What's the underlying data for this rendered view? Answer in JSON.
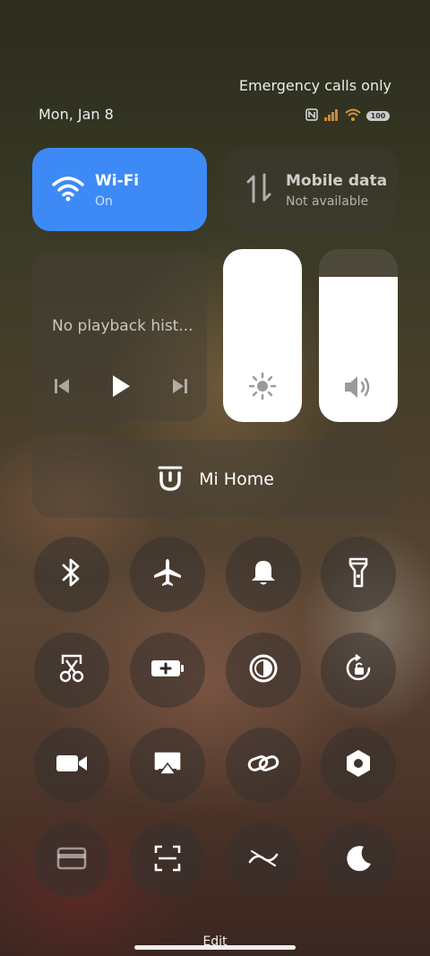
{
  "status": {
    "date": "Mon, Jan 8",
    "carrier": "Emergency calls only",
    "battery": "100"
  },
  "wifi": {
    "title": "Wi-Fi",
    "state": "On",
    "color": "#3d8af7"
  },
  "mobile_data": {
    "title": "Mobile data",
    "state": "Not available"
  },
  "media": {
    "text": "No playback hist..."
  },
  "sliders": {
    "brightness_level": 1.0,
    "volume_level": 0.84
  },
  "mi_home": {
    "label": "Mi Home"
  },
  "toggles": [
    {
      "icon": "bluetooth-icon"
    },
    {
      "icon": "airplane-icon"
    },
    {
      "icon": "bell-icon"
    },
    {
      "icon": "flashlight-icon"
    },
    {
      "icon": "screenshot-icon"
    },
    {
      "icon": "battery-saver-icon"
    },
    {
      "icon": "dark-mode-icon"
    },
    {
      "icon": "rotation-lock-icon"
    },
    {
      "icon": "video-icon"
    },
    {
      "icon": "cast-icon"
    },
    {
      "icon": "link-icon"
    },
    {
      "icon": "settings-hex-icon"
    },
    {
      "icon": "card-icon"
    },
    {
      "icon": "scanner-icon"
    },
    {
      "icon": "data-saver-icon"
    },
    {
      "icon": "moon-icon"
    }
  ],
  "footer": {
    "edit_label": "Edit"
  }
}
